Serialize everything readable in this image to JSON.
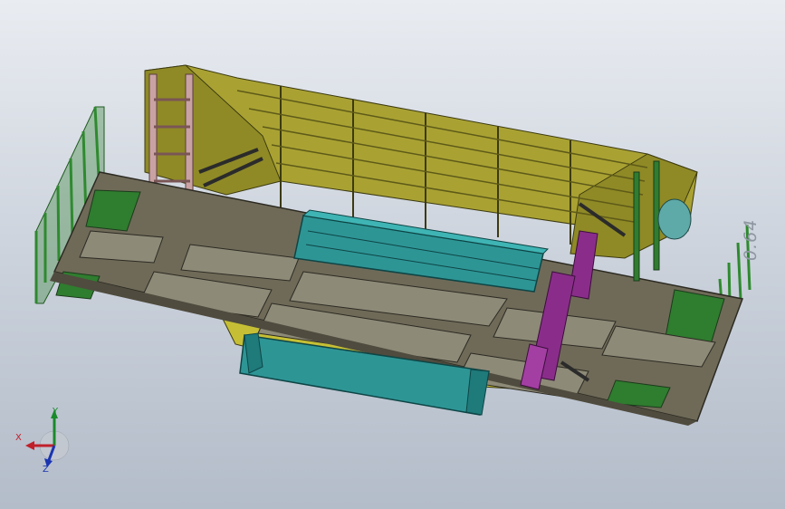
{
  "viewport": {
    "background_top": "#e9ecf1",
    "background_bottom": "#b3bcc9"
  },
  "model": {
    "name": "",
    "colors": {
      "hopper_body": "#a9a233",
      "hopper_shadow": "#7d7a22",
      "frame": "#6f6a58",
      "frame_dark": "#4f4b3e",
      "green_parts": "#2f7d2f",
      "teal_parts": "#2e9595",
      "purple_parts": "#8a2d8a",
      "pink_ladder": "#c9a3a3",
      "yellow_panel": "#d8d33a"
    }
  },
  "triad": {
    "x_label": "X",
    "y_label": "Y",
    "z_label": "Z",
    "x_color": "#c0202a",
    "y_color": "#1a8a2a",
    "z_color": "#1b34b0"
  },
  "view_readout": {
    "text": "0.64"
  }
}
